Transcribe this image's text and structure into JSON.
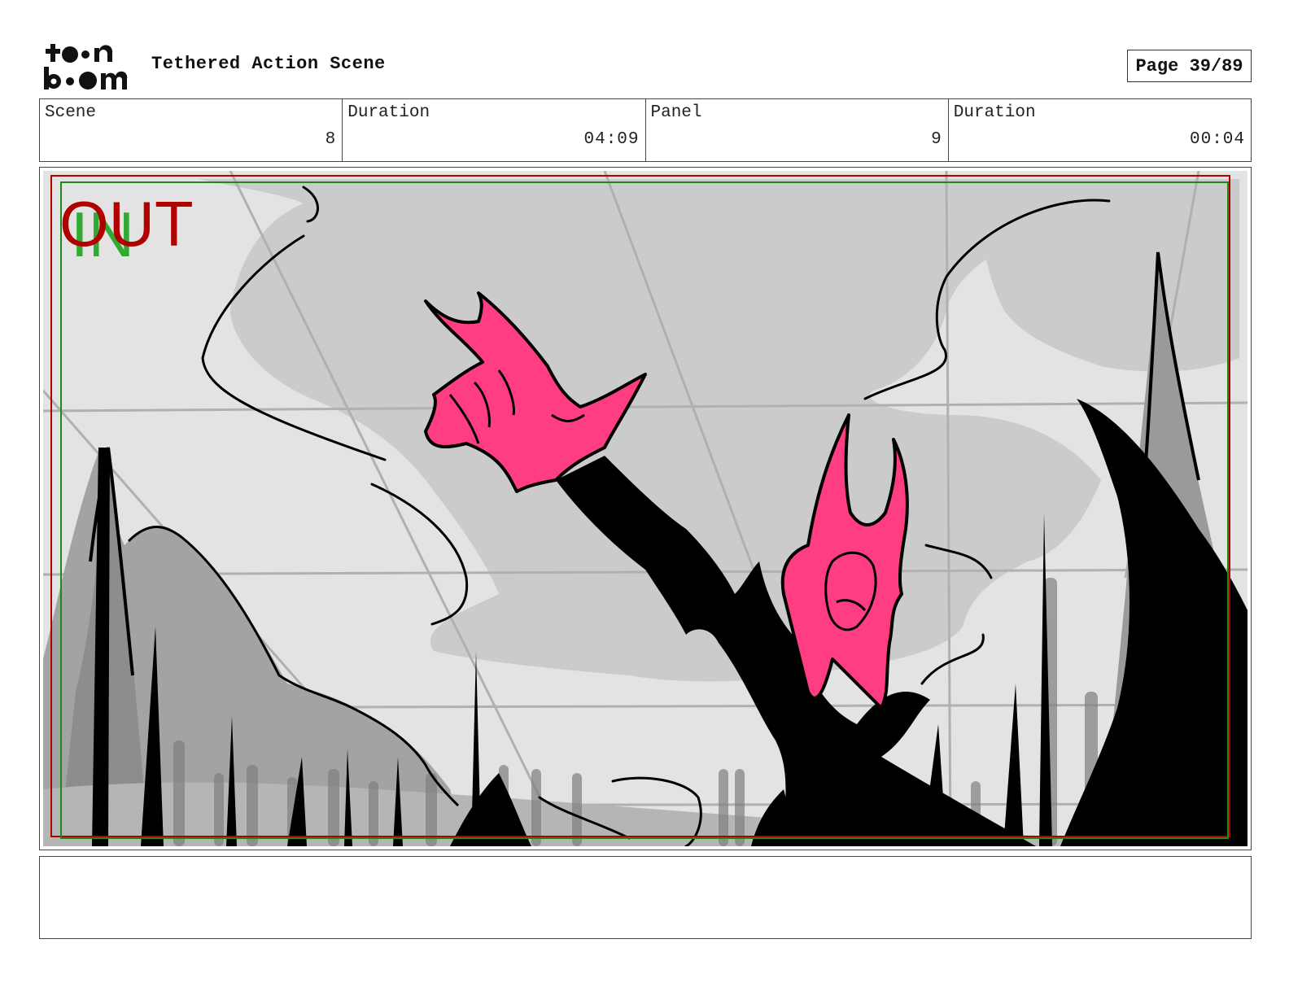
{
  "header": {
    "logo_text": "toon boom",
    "project_title": "Tethered Action Scene",
    "page_label": "Page 39/89"
  },
  "info": [
    {
      "label": "Scene",
      "value": "8"
    },
    {
      "label": "Duration",
      "value": "04:09"
    },
    {
      "label": "Panel",
      "value": "9"
    },
    {
      "label": "Duration",
      "value": "00:04"
    }
  ],
  "panel": {
    "camera_out_label": "OUT",
    "camera_in_label": "IN",
    "colors": {
      "sky_light": "#e3e3e3",
      "sky_mid": "#cbcbcb",
      "rock_gray": "#9a9a9a",
      "ink": "#000000",
      "character_pink": "#ff3d83",
      "out_frame": "#b00000",
      "in_frame": "#1a8a1a"
    }
  },
  "notes": {
    "text": ""
  }
}
